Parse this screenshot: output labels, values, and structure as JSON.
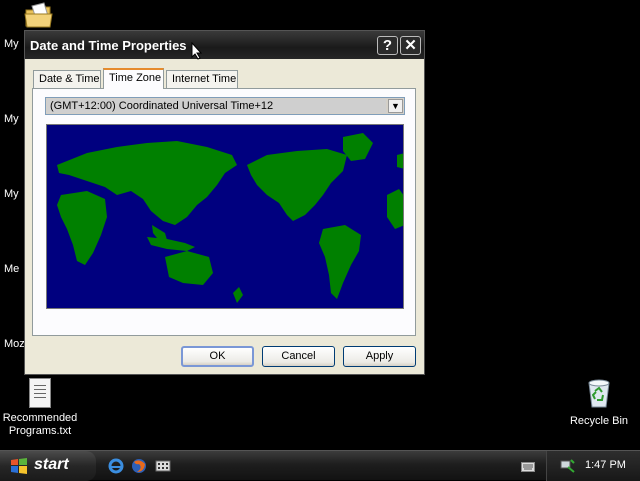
{
  "desktop": {
    "left_labels": [
      "My",
      "My",
      "My",
      "Me",
      "Moz"
    ],
    "icons": [
      {
        "label_line1": "Recommended",
        "label_line2": "Programs.txt"
      },
      {
        "label": "Recycle Bin"
      }
    ]
  },
  "dialog": {
    "title": "Date and Time Properties",
    "help_symbol": "?",
    "close_symbol": "✕",
    "tabs": [
      {
        "label": "Date & Time",
        "active": false
      },
      {
        "label": "Time Zone",
        "active": true
      },
      {
        "label": "Internet Time",
        "active": false
      }
    ],
    "timezone": {
      "selected": "(GMT+12:00) Coordinated Universal Time+12",
      "arrow_symbol": "▼"
    },
    "map_colors": {
      "ocean": "#00007f",
      "land": "#008000"
    },
    "buttons": {
      "ok": "OK",
      "cancel": "Cancel",
      "apply": "Apply"
    }
  },
  "taskbar": {
    "start_label": "start",
    "clock": "1:47 PM"
  }
}
